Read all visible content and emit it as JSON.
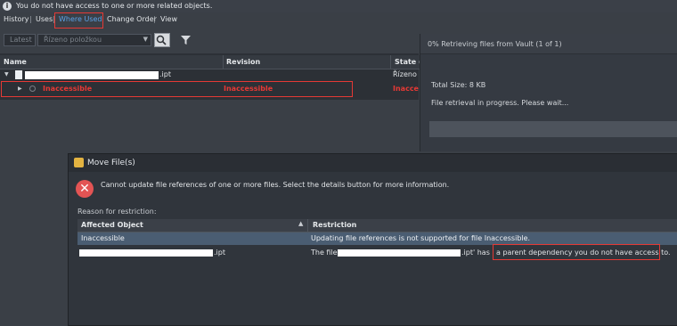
{
  "info_bar": {
    "text": "You do not have access to one or more related objects."
  },
  "tabs": [
    {
      "label": "History"
    },
    {
      "label": "Uses"
    },
    {
      "label": "Where Used"
    },
    {
      "label": "Change Order"
    },
    {
      "label": "View"
    }
  ],
  "toolbar": {
    "version_filter": "Latest",
    "item_filter_placeholder": "Řízeno položkou"
  },
  "grid": {
    "columns": [
      "Name",
      "Revision",
      "State (I"
    ],
    "rows": [
      {
        "name_suffix": ".ipt",
        "revision": "",
        "state": "Řízeno p"
      },
      {
        "name": "Inaccessible",
        "revision": "Inaccessible",
        "state": "Inaccessi"
      }
    ]
  },
  "retrieve_panel": {
    "title": "0% Retrieving files from Vault (1 of 1)",
    "total_size": "Total Size: 8 KB",
    "status": "File retrieval in progress. Please wait..."
  },
  "dialog": {
    "title": "Move File(s)",
    "message": "Cannot update file references of one or more files. Select the details button for more information.",
    "reason_label": "Reason for restriction:",
    "columns": {
      "affected": "Affected Object",
      "restriction": "Restriction"
    },
    "rows": [
      {
        "affected": "Inaccessible",
        "restriction": "Updating file references is not supported for file Inaccessible."
      },
      {
        "affected_suffix": ".ipt",
        "restriction_prefix": "The file '",
        "restriction_mid": ".ipt' has",
        "restriction_highlight": "a parent dependency you do not have access to."
      }
    ]
  },
  "colors": {
    "accent": "#5aa2e8",
    "error": "#e53935",
    "selected_row": "#4a5d72"
  }
}
